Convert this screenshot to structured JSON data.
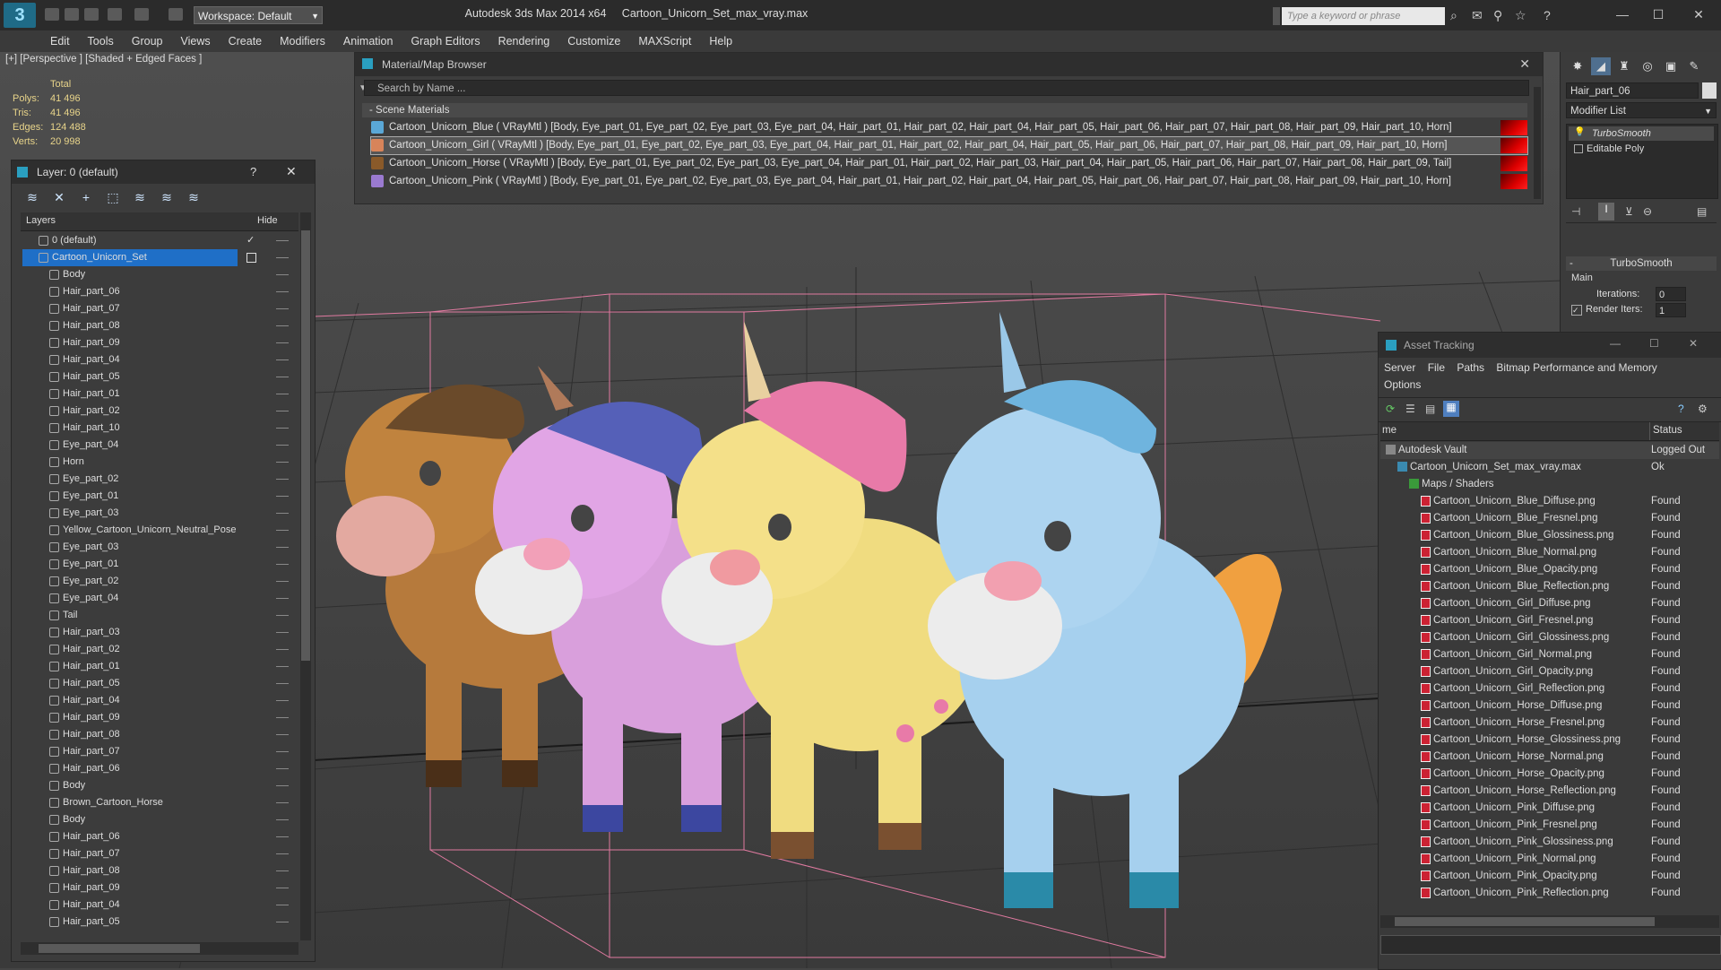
{
  "titlebar": {
    "workspace": "Workspace: Default",
    "app_name": "Autodesk 3ds Max  2014 x64",
    "file_name": "Cartoon_Unicorn_Set_max_vray.max",
    "search_placeholder": "Type a keyword or phrase"
  },
  "menu": [
    "Edit",
    "Tools",
    "Group",
    "Views",
    "Create",
    "Modifiers",
    "Animation",
    "Graph Editors",
    "Rendering",
    "Customize",
    "MAXScript",
    "Help"
  ],
  "viewport": {
    "label": "[+] [Perspective ] [Shaded + Edged Faces ]",
    "stats": {
      "total_label": "Total",
      "rows": [
        {
          "k": "Polys:",
          "v": "41 496"
        },
        {
          "k": "Tris:",
          "v": "41 496"
        },
        {
          "k": "Edges:",
          "v": "124 488"
        },
        {
          "k": "Verts:",
          "v": "20 998"
        }
      ]
    }
  },
  "material_browser": {
    "title": "Material/Map Browser",
    "search": "Search by Name ...",
    "section": "- Scene Materials",
    "rows": [
      {
        "text": "Cartoon_Unicorn_Blue  ( VRayMtl ) [Body, Eye_part_01, Eye_part_02, Eye_part_03, Eye_part_04, Hair_part_01, Hair_part_02, Hair_part_04, Hair_part_05, Hair_part_06, Hair_part_07, Hair_part_08, Hair_part_09, Hair_part_10, Horn]",
        "color": "#5aa7d6"
      },
      {
        "text": "Cartoon_Unicorn_Girl  ( VRayMtl ) [Body, Eye_part_01, Eye_part_02, Eye_part_03, Eye_part_04, Hair_part_01, Hair_part_02, Hair_part_04, Hair_part_05, Hair_part_06, Hair_part_07, Hair_part_08, Hair_part_09, Hair_part_10, Horn]",
        "color": "#d8845a"
      },
      {
        "text": "Cartoon_Unicorn_Horse  ( VRayMtl ) [Body, Eye_part_01, Eye_part_02, Eye_part_03, Eye_part_04, Hair_part_01, Hair_part_02, Hair_part_03, Hair_part_04, Hair_part_05, Hair_part_06, Hair_part_07, Hair_part_08, Hair_part_09, Tail]",
        "color": "#8a5a2a"
      },
      {
        "text": "Cartoon_Unicorn_Pink  ( VRayMtl ) [Body, Eye_part_01, Eye_part_02, Eye_part_03, Eye_part_04, Hair_part_01, Hair_part_02, Hair_part_04, Hair_part_05, Hair_part_06, Hair_part_07, Hair_part_08, Hair_part_09, Hair_part_10, Horn]",
        "color": "#9a7ad0"
      }
    ]
  },
  "layers": {
    "title": "Layer: 0 (default)",
    "help": "?",
    "col_layers": "Layers",
    "col_hide": "Hide",
    "rows": [
      {
        "label": "0 (default)",
        "indent": 1,
        "check": true
      },
      {
        "label": "Cartoon_Unicorn_Set",
        "indent": 1,
        "selected": true
      },
      {
        "label": "Body",
        "indent": 2
      },
      {
        "label": "Hair_part_06",
        "indent": 2
      },
      {
        "label": "Hair_part_07",
        "indent": 2
      },
      {
        "label": "Hair_part_08",
        "indent": 2
      },
      {
        "label": "Hair_part_09",
        "indent": 2
      },
      {
        "label": "Hair_part_04",
        "indent": 2
      },
      {
        "label": "Hair_part_05",
        "indent": 2
      },
      {
        "label": "Hair_part_01",
        "indent": 2
      },
      {
        "label": "Hair_part_02",
        "indent": 2
      },
      {
        "label": "Hair_part_10",
        "indent": 2
      },
      {
        "label": "Eye_part_04",
        "indent": 2
      },
      {
        "label": "Horn",
        "indent": 2
      },
      {
        "label": "Eye_part_02",
        "indent": 2
      },
      {
        "label": "Eye_part_01",
        "indent": 2
      },
      {
        "label": "Eye_part_03",
        "indent": 2
      },
      {
        "label": "Yellow_Cartoon_Unicorn_Neutral_Pose",
        "indent": 2
      },
      {
        "label": "Eye_part_03",
        "indent": 2
      },
      {
        "label": "Eye_part_01",
        "indent": 2
      },
      {
        "label": "Eye_part_02",
        "indent": 2
      },
      {
        "label": "Eye_part_04",
        "indent": 2
      },
      {
        "label": "Tail",
        "indent": 2
      },
      {
        "label": "Hair_part_03",
        "indent": 2
      },
      {
        "label": "Hair_part_02",
        "indent": 2
      },
      {
        "label": "Hair_part_01",
        "indent": 2
      },
      {
        "label": "Hair_part_05",
        "indent": 2
      },
      {
        "label": "Hair_part_04",
        "indent": 2
      },
      {
        "label": "Hair_part_09",
        "indent": 2
      },
      {
        "label": "Hair_part_08",
        "indent": 2
      },
      {
        "label": "Hair_part_07",
        "indent": 2
      },
      {
        "label": "Hair_part_06",
        "indent": 2
      },
      {
        "label": "Body",
        "indent": 2
      },
      {
        "label": "Brown_Cartoon_Horse",
        "indent": 2
      },
      {
        "label": "Body",
        "indent": 2
      },
      {
        "label": "Hair_part_06",
        "indent": 2
      },
      {
        "label": "Hair_part_07",
        "indent": 2
      },
      {
        "label": "Hair_part_08",
        "indent": 2
      },
      {
        "label": "Hair_part_09",
        "indent": 2
      },
      {
        "label": "Hair_part_04",
        "indent": 2
      },
      {
        "label": "Hair_part_05",
        "indent": 2
      }
    ]
  },
  "command_panel": {
    "object_name": "Hair_part_06",
    "modifier_list": "Modifier List",
    "stack": [
      "TurboSmooth",
      "Editable Poly"
    ],
    "rollout_title": "TurboSmooth",
    "group_main": "Main",
    "iterations_label": "Iterations:",
    "iterations_value": "0",
    "render_iters_label": "Render Iters:",
    "render_iters_value": "1"
  },
  "asset_tracking": {
    "title": "Asset Tracking",
    "menu": [
      "Server",
      "File",
      "Paths",
      "Bitmap Performance and Memory",
      "Options"
    ],
    "col_name": "me",
    "col_status": "Status",
    "rows": [
      {
        "name": "Autodesk Vault",
        "status": "Logged Out",
        "level": 0,
        "kind": "vault"
      },
      {
        "name": "Cartoon_Unicorn_Set_max_vray.max",
        "status": "Ok",
        "level": 1,
        "kind": "max"
      },
      {
        "name": "Maps / Shaders",
        "status": "",
        "level": 2,
        "kind": "folder"
      },
      {
        "name": "Cartoon_Unicorn_Blue_Diffuse.png",
        "status": "Found",
        "level": 3,
        "kind": "png"
      },
      {
        "name": "Cartoon_Unicorn_Blue_Fresnel.png",
        "status": "Found",
        "level": 3,
        "kind": "png"
      },
      {
        "name": "Cartoon_Unicorn_Blue_Glossiness.png",
        "status": "Found",
        "level": 3,
        "kind": "png"
      },
      {
        "name": "Cartoon_Unicorn_Blue_Normal.png",
        "status": "Found",
        "level": 3,
        "kind": "png"
      },
      {
        "name": "Cartoon_Unicorn_Blue_Opacity.png",
        "status": "Found",
        "level": 3,
        "kind": "png"
      },
      {
        "name": "Cartoon_Unicorn_Blue_Reflection.png",
        "status": "Found",
        "level": 3,
        "kind": "png"
      },
      {
        "name": "Cartoon_Unicorn_Girl_Diffuse.png",
        "status": "Found",
        "level": 3,
        "kind": "png"
      },
      {
        "name": "Cartoon_Unicorn_Girl_Fresnel.png",
        "status": "Found",
        "level": 3,
        "kind": "png"
      },
      {
        "name": "Cartoon_Unicorn_Girl_Glossiness.png",
        "status": "Found",
        "level": 3,
        "kind": "png"
      },
      {
        "name": "Cartoon_Unicorn_Girl_Normal.png",
        "status": "Found",
        "level": 3,
        "kind": "png"
      },
      {
        "name": "Cartoon_Unicorn_Girl_Opacity.png",
        "status": "Found",
        "level": 3,
        "kind": "png"
      },
      {
        "name": "Cartoon_Unicorn_Girl_Reflection.png",
        "status": "Found",
        "level": 3,
        "kind": "png"
      },
      {
        "name": "Cartoon_Unicorn_Horse_Diffuse.png",
        "status": "Found",
        "level": 3,
        "kind": "png"
      },
      {
        "name": "Cartoon_Unicorn_Horse_Fresnel.png",
        "status": "Found",
        "level": 3,
        "kind": "png"
      },
      {
        "name": "Cartoon_Unicorn_Horse_Glossiness.png",
        "status": "Found",
        "level": 3,
        "kind": "png"
      },
      {
        "name": "Cartoon_Unicorn_Horse_Normal.png",
        "status": "Found",
        "level": 3,
        "kind": "png"
      },
      {
        "name": "Cartoon_Unicorn_Horse_Opacity.png",
        "status": "Found",
        "level": 3,
        "kind": "png"
      },
      {
        "name": "Cartoon_Unicorn_Horse_Reflection.png",
        "status": "Found",
        "level": 3,
        "kind": "png"
      },
      {
        "name": "Cartoon_Unicorn_Pink_Diffuse.png",
        "status": "Found",
        "level": 3,
        "kind": "png"
      },
      {
        "name": "Cartoon_Unicorn_Pink_Fresnel.png",
        "status": "Found",
        "level": 3,
        "kind": "png"
      },
      {
        "name": "Cartoon_Unicorn_Pink_Glossiness.png",
        "status": "Found",
        "level": 3,
        "kind": "png"
      },
      {
        "name": "Cartoon_Unicorn_Pink_Normal.png",
        "status": "Found",
        "level": 3,
        "kind": "png"
      },
      {
        "name": "Cartoon_Unicorn_Pink_Opacity.png",
        "status": "Found",
        "level": 3,
        "kind": "png"
      },
      {
        "name": "Cartoon_Unicorn_Pink_Reflection.png",
        "status": "Found",
        "level": 3,
        "kind": "png"
      }
    ]
  },
  "colors": {
    "selection": "#1f6fc7",
    "material_red": "#dd1111",
    "stats_yellow": "#e8d48a"
  }
}
